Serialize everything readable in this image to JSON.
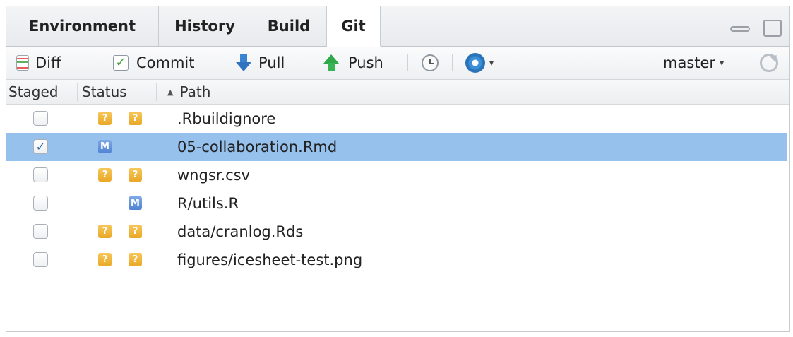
{
  "tabs": [
    {
      "label": "Environment",
      "active": false
    },
    {
      "label": "History",
      "active": false
    },
    {
      "label": "Build",
      "active": false
    },
    {
      "label": "Git",
      "active": true
    }
  ],
  "toolbar": {
    "diff_label": "Diff",
    "commit_label": "Commit",
    "pull_label": "Pull",
    "push_label": "Push",
    "branch_label": "master",
    "branch_caret": "▾",
    "gear_caret": "▾"
  },
  "columns": {
    "staged": "Staged",
    "status": "Status",
    "path": "Path",
    "sort_indicator": "▲"
  },
  "files": [
    {
      "staged": false,
      "staged_status": "?",
      "unstaged_status": "?",
      "path": ".Rbuildignore",
      "selected": false
    },
    {
      "staged": true,
      "staged_status": "M",
      "unstaged_status": "",
      "path": "05-collaboration.Rmd",
      "selected": true
    },
    {
      "staged": false,
      "staged_status": "?",
      "unstaged_status": "?",
      "path": "wngsr.csv",
      "selected": false
    },
    {
      "staged": false,
      "staged_status": "",
      "unstaged_status": "M",
      "path": "R/utils.R",
      "selected": false
    },
    {
      "staged": false,
      "staged_status": "?",
      "unstaged_status": "?",
      "path": "data/cranlog.Rds",
      "selected": false
    },
    {
      "staged": false,
      "staged_status": "?",
      "unstaged_status": "?",
      "path": "figures/icesheet-test.png",
      "selected": false
    }
  ],
  "colors": {
    "selection": "#96c1ed",
    "untracked_badge": "#f0b93a",
    "modified_badge": "#5a8fd8",
    "pull_arrow": "#3a83d1",
    "push_arrow": "#2fa84a"
  },
  "icons": {
    "diff": "diff-icon",
    "commit": "commit-icon",
    "pull": "pull-arrow-down-icon",
    "push": "push-arrow-up-icon",
    "history": "clock-icon",
    "more": "gear-icon",
    "refresh": "refresh-icon",
    "minimize": "minimize-icon",
    "maximize": "maximize-icon"
  }
}
